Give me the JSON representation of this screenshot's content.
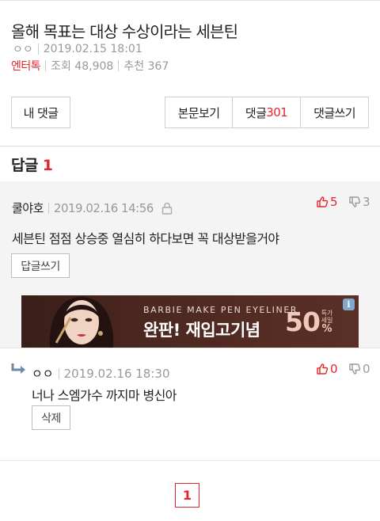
{
  "post": {
    "title": "올해 목표는 대상 수상이라는 세븐틴",
    "author": "ㅇㅇ",
    "datetime": "2019.02.15 18:01",
    "category": "엔터톡",
    "views": "조회 48,908",
    "recommends": "추천 367"
  },
  "buttons": {
    "my_comments": "내 댓글",
    "view_body": "본문보기",
    "comments_label": "댓글",
    "comments_count": "301",
    "write_comment": "댓글쓰기"
  },
  "replies": {
    "label": "답글",
    "count": "1"
  },
  "comment": {
    "author": "쿨야호",
    "datetime": "2019.02.16 14:56",
    "likes": "5",
    "dislikes": "3",
    "text": "세븐틴 점점 상승중 열심히 하다보면 꼭 대상받을거야",
    "reply_button": "답글쓰기"
  },
  "ad": {
    "top_text": "BARBIE MAKE PEN EYELINER",
    "main_text": "완판! 재입고기념",
    "percent": "50",
    "percent_sign": "%",
    "side_text": "특가 세일",
    "info": "i"
  },
  "reply": {
    "author": "ㅇㅇ",
    "datetime": "2019.02.16 18:30",
    "likes": "0",
    "dislikes": "0",
    "text": "너나 스엠가수 까지마 병신아",
    "delete_button": "삭제"
  },
  "pagination": {
    "current": "1"
  },
  "colors": {
    "accent": "#e8252b",
    "meta": "#999999",
    "comment_bg": "#f4f4f4"
  }
}
